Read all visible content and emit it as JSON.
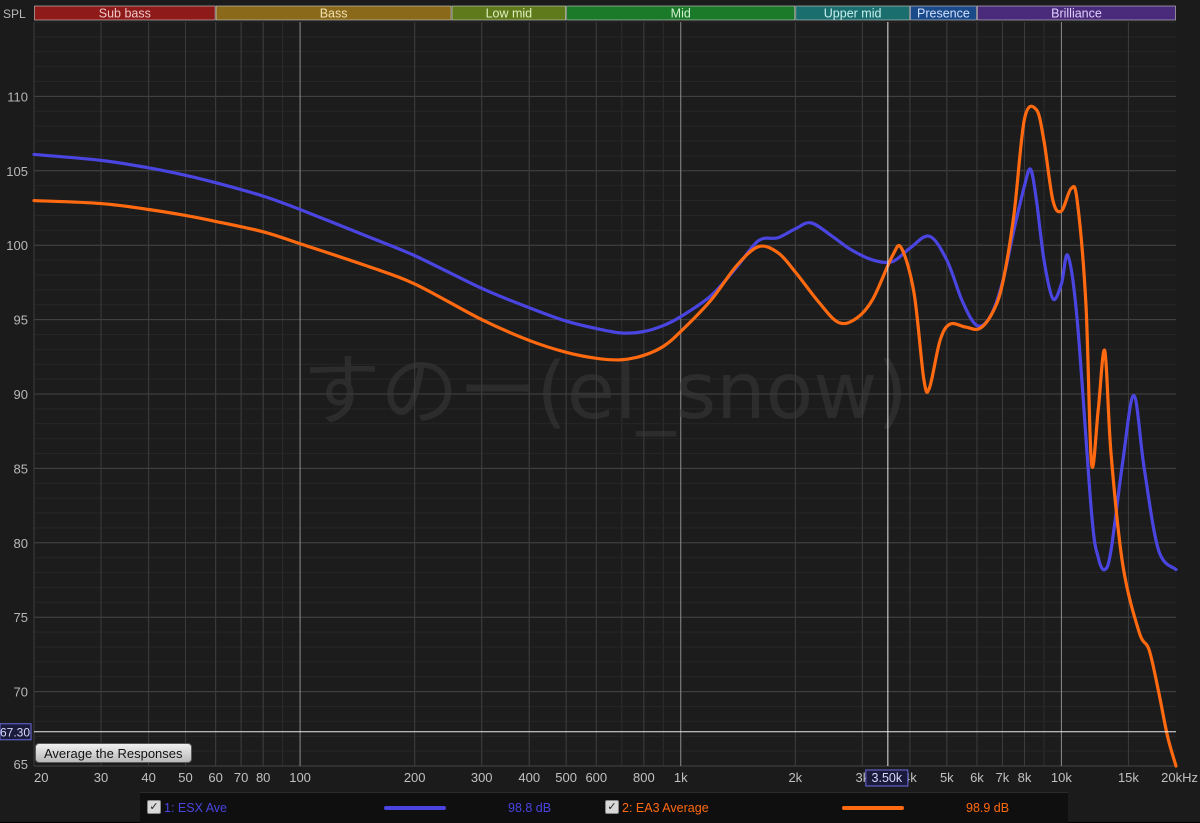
{
  "bands": [
    {
      "label": "Sub bass",
      "from": 20,
      "to": 60,
      "color": "#8e1a1a",
      "text": "#f0c8c8"
    },
    {
      "label": "Bass",
      "from": 60,
      "to": 250,
      "color": "#8a6a1a",
      "text": "#f0e0b0"
    },
    {
      "label": "Low mid",
      "from": 250,
      "to": 500,
      "color": "#5e7a1a",
      "text": "#e0f0c0"
    },
    {
      "label": "Mid",
      "from": 500,
      "to": 2000,
      "color": "#1a7a2a",
      "text": "#d0f0d0"
    },
    {
      "label": "Upper mid",
      "from": 2000,
      "to": 4000,
      "color": "#1a6e6e",
      "text": "#c8f0f0"
    },
    {
      "label": "Presence",
      "from": 4000,
      "to": 6000,
      "color": "#1a4a8a",
      "text": "#d0e0ff"
    },
    {
      "label": "Brilliance",
      "from": 6000,
      "to": 20000,
      "color": "#4a2a7a",
      "text": "#e0d0ff"
    }
  ],
  "axis": {
    "y_label": "SPL",
    "x_unit_label": "20kHz",
    "cursor_x_label": "3.50k",
    "cursor_y_label": "67.30",
    "y_ticks": [
      "65",
      "70",
      "75",
      "80",
      "85",
      "90",
      "95",
      "100",
      "105",
      "110"
    ],
    "x_ticks": [
      {
        "v": 20,
        "t": "20"
      },
      {
        "v": 30,
        "t": "30"
      },
      {
        "v": 40,
        "t": "40"
      },
      {
        "v": 50,
        "t": "50"
      },
      {
        "v": 60,
        "t": "60"
      },
      {
        "v": 70,
        "t": "70"
      },
      {
        "v": 80,
        "t": "80"
      },
      {
        "v": 100,
        "t": "100"
      },
      {
        "v": 200,
        "t": "200"
      },
      {
        "v": 300,
        "t": "300"
      },
      {
        "v": 400,
        "t": "400"
      },
      {
        "v": 500,
        "t": "500"
      },
      {
        "v": 600,
        "t": "600"
      },
      {
        "v": 800,
        "t": "800"
      },
      {
        "v": 1000,
        "t": "1k"
      },
      {
        "v": 2000,
        "t": "2k"
      },
      {
        "v": 3000,
        "t": "3k"
      },
      {
        "v": 4000,
        "t": "4k"
      },
      {
        "v": 5000,
        "t": "5k"
      },
      {
        "v": 6000,
        "t": "6k"
      },
      {
        "v": 7000,
        "t": "7k"
      },
      {
        "v": 8000,
        "t": "8k"
      },
      {
        "v": 10000,
        "t": "10k"
      },
      {
        "v": 15000,
        "t": "15k"
      }
    ]
  },
  "watermark": "すのー(el_snow)",
  "average_button": "Average the Responses",
  "legend": [
    {
      "check": "✓",
      "name": "1: ESX Ave",
      "value": "98.8 dB",
      "color": "#4a45e0"
    },
    {
      "check": "✓",
      "name": "2: EA3 Average",
      "value": "98.9 dB",
      "color": "#ff6a10"
    }
  ],
  "chart_data": {
    "type": "line",
    "x_scale": "log",
    "xlim": [
      20,
      20000
    ],
    "ylim": [
      65,
      115
    ],
    "cursor": {
      "x": 3500,
      "y": 67.3
    },
    "series": [
      {
        "name": "1: ESX Ave",
        "color": "#4a45e0",
        "points": [
          [
            20,
            106.1
          ],
          [
            30,
            105.7
          ],
          [
            40,
            105.2
          ],
          [
            50,
            104.7
          ],
          [
            60,
            104.2
          ],
          [
            80,
            103.3
          ],
          [
            100,
            102.4
          ],
          [
            150,
            100.6
          ],
          [
            200,
            99.3
          ],
          [
            300,
            97.1
          ],
          [
            400,
            95.8
          ],
          [
            500,
            94.9
          ],
          [
            600,
            94.4
          ],
          [
            700,
            94.1
          ],
          [
            800,
            94.2
          ],
          [
            900,
            94.6
          ],
          [
            1000,
            95.2
          ],
          [
            1200,
            96.6
          ],
          [
            1400,
            98.5
          ],
          [
            1600,
            100.3
          ],
          [
            1800,
            100.5
          ],
          [
            2000,
            101.1
          ],
          [
            2200,
            101.5
          ],
          [
            2500,
            100.6
          ],
          [
            2800,
            99.7
          ],
          [
            3200,
            99.0
          ],
          [
            3600,
            98.9
          ],
          [
            4000,
            99.8
          ],
          [
            4500,
            100.6
          ],
          [
            5000,
            99.0
          ],
          [
            5500,
            96.2
          ],
          [
            6000,
            94.6
          ],
          [
            6500,
            95.2
          ],
          [
            7000,
            97.5
          ],
          [
            7500,
            101.0
          ],
          [
            8000,
            104.0
          ],
          [
            8300,
            105.1
          ],
          [
            8600,
            103.0
          ],
          [
            9000,
            99.0
          ],
          [
            9500,
            96.4
          ],
          [
            10000,
            97.4
          ],
          [
            10400,
            99.3
          ],
          [
            11000,
            95.0
          ],
          [
            12000,
            82.0
          ],
          [
            12500,
            79.0
          ],
          [
            13000,
            78.2
          ],
          [
            13500,
            79.5
          ],
          [
            14500,
            85.5
          ],
          [
            15500,
            89.9
          ],
          [
            16500,
            85.0
          ],
          [
            18000,
            79.5
          ],
          [
            20000,
            78.2
          ]
        ]
      },
      {
        "name": "2: EA3 Average",
        "color": "#ff6a10",
        "points": [
          [
            20,
            103.0
          ],
          [
            30,
            102.8
          ],
          [
            40,
            102.4
          ],
          [
            50,
            102.0
          ],
          [
            60,
            101.6
          ],
          [
            80,
            100.9
          ],
          [
            100,
            100.1
          ],
          [
            150,
            98.6
          ],
          [
            200,
            97.4
          ],
          [
            300,
            95.0
          ],
          [
            400,
            93.6
          ],
          [
            500,
            92.8
          ],
          [
            600,
            92.4
          ],
          [
            700,
            92.3
          ],
          [
            800,
            92.6
          ],
          [
            900,
            93.2
          ],
          [
            1000,
            94.2
          ],
          [
            1200,
            96.3
          ],
          [
            1400,
            98.6
          ],
          [
            1600,
            99.9
          ],
          [
            1800,
            99.5
          ],
          [
            2000,
            98.2
          ],
          [
            2300,
            96.2
          ],
          [
            2600,
            94.8
          ],
          [
            2900,
            95.1
          ],
          [
            3200,
            96.4
          ],
          [
            3600,
            99.3
          ],
          [
            3800,
            99.8
          ],
          [
            4100,
            96.8
          ],
          [
            4350,
            91.0
          ],
          [
            4500,
            90.4
          ],
          [
            4800,
            93.6
          ],
          [
            5100,
            94.7
          ],
          [
            5600,
            94.5
          ],
          [
            6100,
            94.4
          ],
          [
            6600,
            95.5
          ],
          [
            7000,
            97.4
          ],
          [
            7500,
            102.0
          ],
          [
            8000,
            108.5
          ],
          [
            8600,
            109.1
          ],
          [
            9000,
            107.0
          ],
          [
            9500,
            103.0
          ],
          [
            10000,
            102.3
          ],
          [
            10600,
            103.8
          ],
          [
            11000,
            103.0
          ],
          [
            11600,
            96.0
          ],
          [
            12000,
            85.3
          ],
          [
            12500,
            89.0
          ],
          [
            13000,
            92.9
          ],
          [
            13500,
            86.0
          ],
          [
            14500,
            78.5
          ],
          [
            16000,
            74.0
          ],
          [
            17000,
            72.8
          ],
          [
            18000,
            70.0
          ],
          [
            19000,
            67.0
          ],
          [
            20000,
            65.0
          ]
        ]
      }
    ]
  }
}
